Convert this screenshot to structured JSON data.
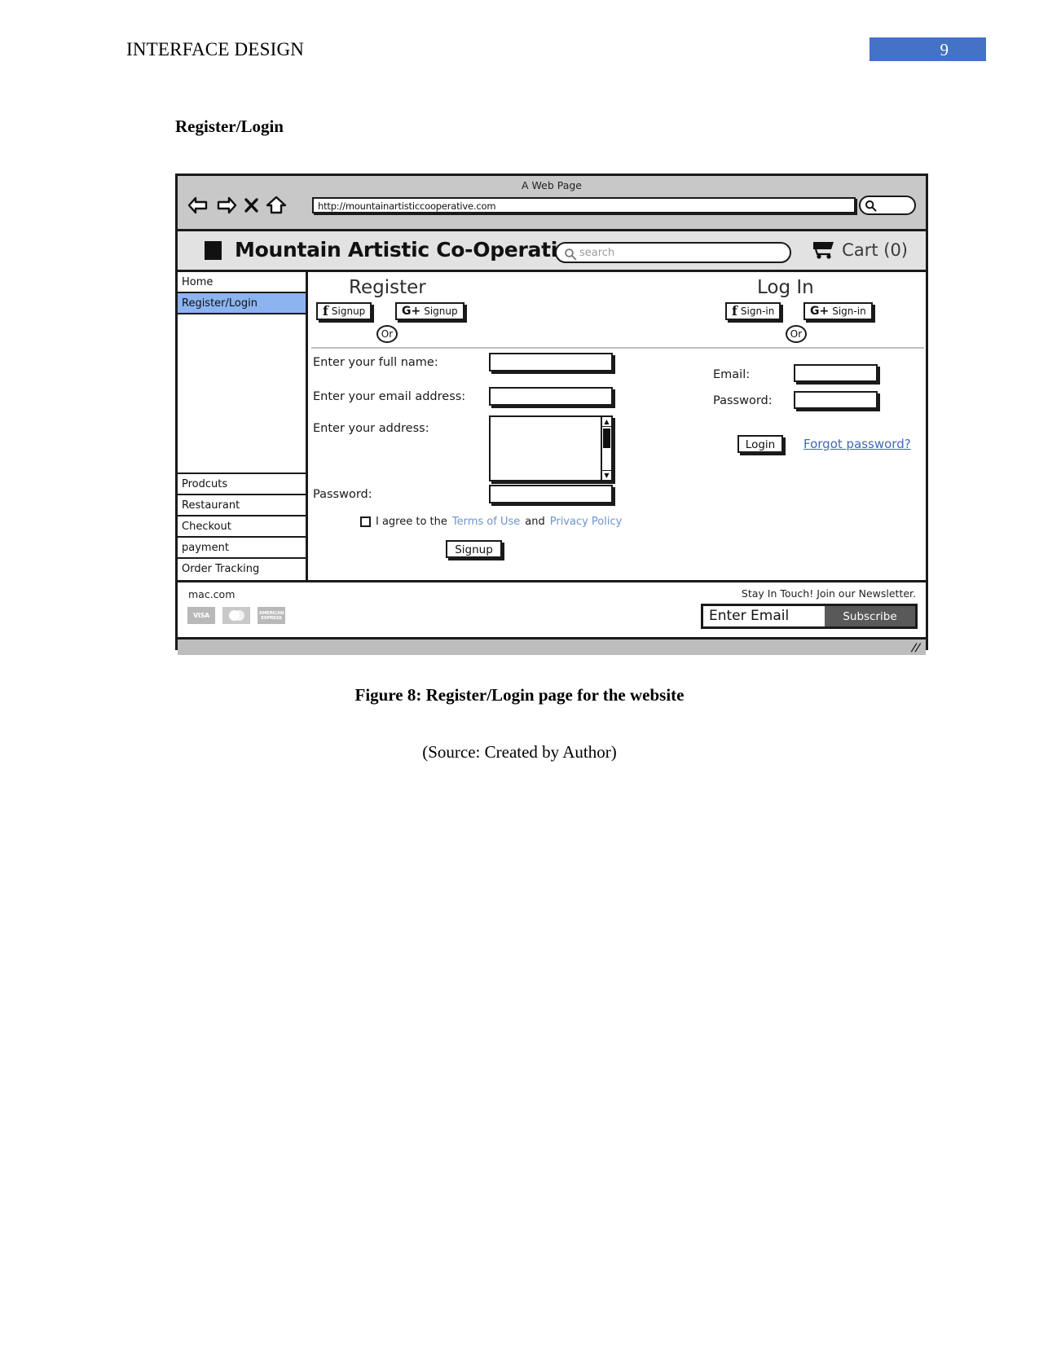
{
  "document": {
    "running_head": "INTERFACE DESIGN",
    "page_number": "9",
    "section_heading": "Register/Login",
    "figure_caption": "Figure 8: Register/Login page for the website",
    "figure_source": "(Source: Created by Author)",
    "accent_color": "#4472C4"
  },
  "browser": {
    "window_title": "A Web Page",
    "url": "http://mountainartisticcooperative.com",
    "nav": {
      "back": "back-arrow-icon",
      "forward": "forward-arrow-icon",
      "stop": "close-x-icon",
      "home": "home-icon",
      "search": "search-icon"
    }
  },
  "site_header": {
    "logo": "square-logo-icon",
    "brand": "Mountain Artistic Co-Operative",
    "search_placeholder": "search",
    "cart_icon": "shopping-cart-icon",
    "cart_label": "Cart (0)"
  },
  "sidebar": {
    "items": [
      {
        "label": "Home",
        "active": false
      },
      {
        "label": "Register/Login",
        "active": true
      },
      {
        "label": "Prodcuts",
        "active": false
      },
      {
        "label": "Restaurant",
        "active": false
      },
      {
        "label": "Checkout",
        "active": false
      },
      {
        "label": "payment",
        "active": false
      },
      {
        "label": "Order Tracking",
        "active": false
      }
    ],
    "active_color": "#8cb4f0"
  },
  "register": {
    "title": "Register",
    "facebook_button": "Signup",
    "google_button": "Signup",
    "or_badge": "Or",
    "fields": {
      "fullname_label": "Enter your full name:",
      "fullname_value": "",
      "email_label": "Enter your email address:",
      "email_value": "",
      "address_label": "Enter your address:",
      "address_value": "",
      "password_label": "Password:",
      "password_value": ""
    },
    "agree_prefix": "I agree to the",
    "terms_link": "Terms of Use",
    "agree_middle": "and",
    "privacy_link": "Privacy Policy",
    "submit_button": "Signup",
    "link_color": "#6e93cf"
  },
  "login": {
    "title": "Log In",
    "facebook_button": "Sign-in",
    "google_button": "Sign-in",
    "or_badge": "Or",
    "fields": {
      "email_label": "Email:",
      "email_value": "",
      "password_label": "Password:",
      "password_value": ""
    },
    "submit_button": "Login",
    "forgot_link": "Forgot password?"
  },
  "footer": {
    "brand": "mac.com",
    "payment_icons": [
      {
        "name": "visa-icon",
        "label": "VISA"
      },
      {
        "name": "mastercard-icon",
        "label": ""
      },
      {
        "name": "amex-icon",
        "label": "AMERICAN EXPRESS"
      }
    ],
    "newsletter_text": "Stay In Touch! Join our Newsletter.",
    "newsletter_placeholder": "Enter Email",
    "newsletter_value": "Enter Email",
    "subscribe_button": "Subscribe"
  }
}
